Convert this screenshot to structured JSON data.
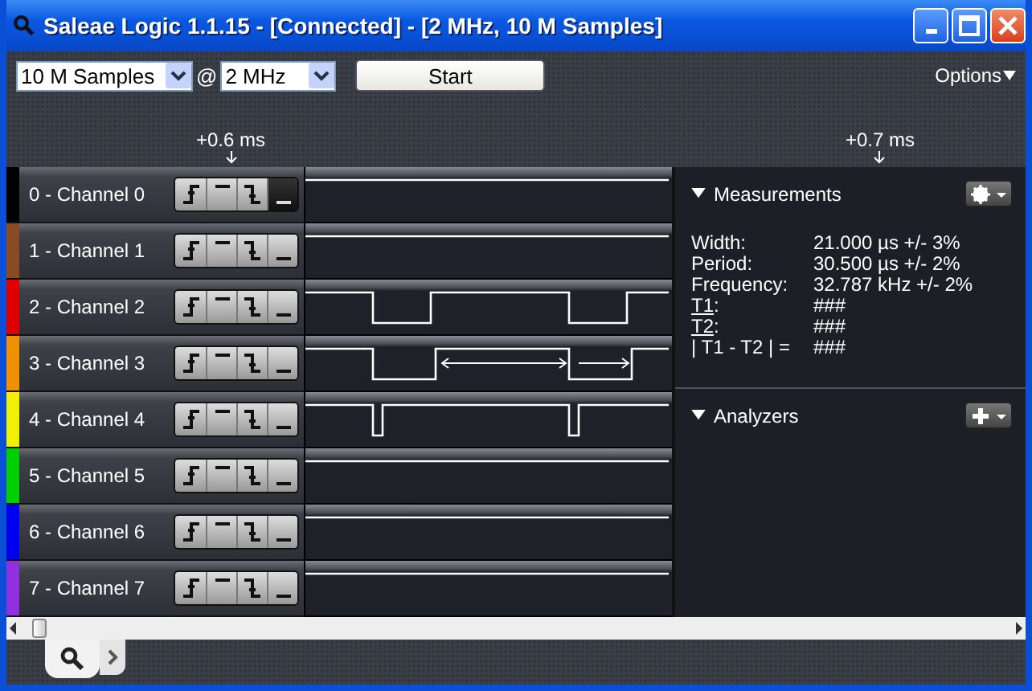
{
  "window": {
    "title": "Saleae Logic 1.1.15 - [Connected] - [2 MHz, 10 M Samples]"
  },
  "toolbar": {
    "samples": "10 M Samples",
    "at": "@",
    "rate": "2 MHz",
    "start_button": "Start",
    "options": "Options"
  },
  "timeline": {
    "markers": [
      "+0.6 ms",
      "+0.7 ms"
    ]
  },
  "channels": [
    {
      "label": "0 - Channel 0",
      "color": "#000000",
      "kind": "idle",
      "triggers": [
        {
          "kind": "rising",
          "selected": false
        },
        {
          "kind": "high",
          "selected": false
        },
        {
          "kind": "falling",
          "selected": false
        },
        {
          "kind": "low",
          "selected": true
        }
      ]
    },
    {
      "label": "1 - Channel 1",
      "color": "#8a4a22",
      "kind": "idle",
      "triggers": [
        {
          "kind": "rising",
          "selected": false
        },
        {
          "kind": "high",
          "selected": false
        },
        {
          "kind": "falling",
          "selected": false
        },
        {
          "kind": "low",
          "selected": false
        }
      ]
    },
    {
      "label": "2 - Channel 2",
      "color": "#e00000",
      "kind": "square",
      "triggers": [
        {
          "kind": "rising",
          "selected": false
        },
        {
          "kind": "high",
          "selected": false
        },
        {
          "kind": "falling",
          "selected": false
        },
        {
          "kind": "low",
          "selected": false
        }
      ]
    },
    {
      "label": "3 - Channel 3",
      "color": "#f09000",
      "kind": "measured",
      "triggers": [
        {
          "kind": "rising",
          "selected": false
        },
        {
          "kind": "high",
          "selected": false
        },
        {
          "kind": "falling",
          "selected": false
        },
        {
          "kind": "low",
          "selected": false
        }
      ]
    },
    {
      "label": "4 - Channel 4",
      "color": "#f0f000",
      "kind": "pulse",
      "triggers": [
        {
          "kind": "rising",
          "selected": false
        },
        {
          "kind": "high",
          "selected": false
        },
        {
          "kind": "falling",
          "selected": false
        },
        {
          "kind": "low",
          "selected": false
        }
      ]
    },
    {
      "label": "5 - Channel 5",
      "color": "#00d000",
      "kind": "idle",
      "triggers": [
        {
          "kind": "rising",
          "selected": false
        },
        {
          "kind": "high",
          "selected": false
        },
        {
          "kind": "falling",
          "selected": false
        },
        {
          "kind": "low",
          "selected": false
        }
      ]
    },
    {
      "label": "6 - Channel 6",
      "color": "#0000f0",
      "kind": "idle",
      "triggers": [
        {
          "kind": "rising",
          "selected": false
        },
        {
          "kind": "high",
          "selected": false
        },
        {
          "kind": "falling",
          "selected": false
        },
        {
          "kind": "low",
          "selected": false
        }
      ]
    },
    {
      "label": "7 - Channel 7",
      "color": "#9030e0",
      "kind": "idle",
      "triggers": [
        {
          "kind": "rising",
          "selected": false
        },
        {
          "kind": "high",
          "selected": false
        },
        {
          "kind": "falling",
          "selected": false
        },
        {
          "kind": "low",
          "selected": false
        }
      ]
    }
  ],
  "measurements": {
    "title": "Measurements",
    "expanded": true,
    "rows": [
      {
        "label": "Width:",
        "link": false,
        "value": "21.000 µs +/- 3%"
      },
      {
        "label": "Period:",
        "link": false,
        "value": "30.500 µs +/- 2%"
      },
      {
        "label": "Frequency:",
        "link": false,
        "value": "32.787 kHz +/- 2%"
      },
      {
        "label": "T1",
        "link": true,
        "after": ":",
        "value": "###"
      },
      {
        "label": "T2",
        "link": true,
        "after": ":",
        "value": "###"
      },
      {
        "label": "| T1 - T2 | =",
        "link": false,
        "value": "###"
      }
    ]
  },
  "analyzers": {
    "title": "Analyzers",
    "expanded": true
  }
}
